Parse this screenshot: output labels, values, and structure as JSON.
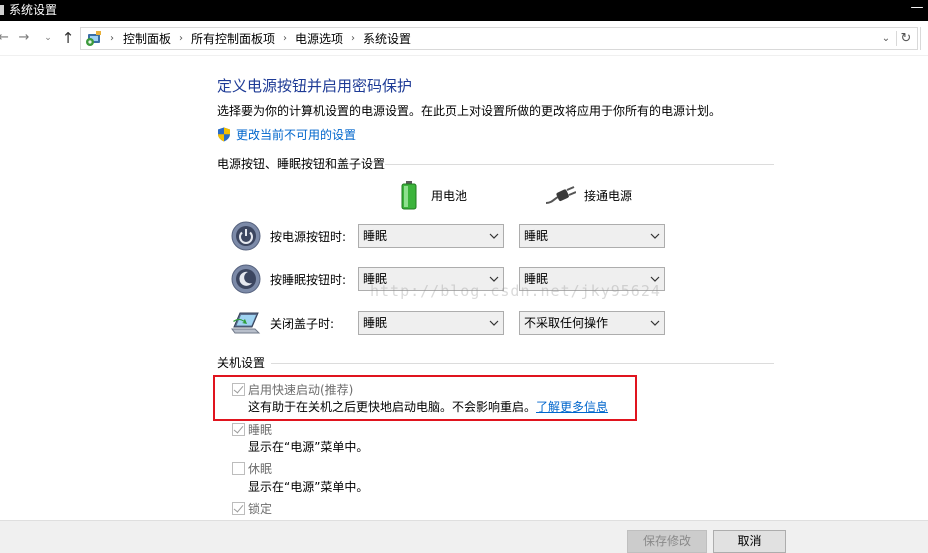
{
  "window": {
    "title": "系统设置",
    "minimize_glyph": "—"
  },
  "nav": {
    "back_icon": "←",
    "forward_icon": "→",
    "recent_icon": "⌄",
    "up_icon": "↑",
    "breadcrumb_separator": "›",
    "breadcrumbs": [
      "控制面板",
      "所有控制面板项",
      "电源选项",
      "系统设置"
    ],
    "dropdown_icon": "⌄",
    "refresh_icon": "↻"
  },
  "header": {
    "title": "定义电源按钮并启用密码保护",
    "description": "选择要为你的计算机设置的电源设置。在此页上对设置所做的更改将应用于你所有的电源计划。",
    "change_settings_link": "更改当前不可用的设置"
  },
  "power_buttons_section": {
    "title": "电源按钮、睡眠按钮和盖子设置",
    "columns": {
      "battery": "用电池",
      "plugged_in": "接通电源"
    },
    "rows": [
      {
        "icon": "power-button-icon",
        "label": "按电源按钮时:",
        "battery": "睡眠",
        "plugged_in": "睡眠"
      },
      {
        "icon": "sleep-button-icon",
        "label": "按睡眠按钮时:",
        "battery": "睡眠",
        "plugged_in": "睡眠"
      },
      {
        "icon": "laptop-lid-icon",
        "label": "关闭盖子时:",
        "battery": "睡眠",
        "plugged_in": "不采取任何操作"
      }
    ]
  },
  "watermark": "http://blog.csdn.net/jky95624",
  "shutdown_section": {
    "title": "关机设置",
    "items": [
      {
        "label": "启用快速启动(推荐)",
        "checked": true,
        "description": "这有助于在关机之后更快地启动电脑。不会影响重启。",
        "link": "了解更多信息"
      },
      {
        "label": "睡眠",
        "checked": true,
        "description": "显示在“电源”菜单中。"
      },
      {
        "label": "休眠",
        "checked": false,
        "description": "显示在“电源”菜单中。"
      },
      {
        "label": "锁定",
        "checked": true
      }
    ]
  },
  "footer": {
    "save_label": "保存修改",
    "cancel_label": "取消"
  },
  "colors": {
    "heading": "#1e3b96",
    "link": "#0066cc",
    "highlight_box": "#e0141e"
  }
}
